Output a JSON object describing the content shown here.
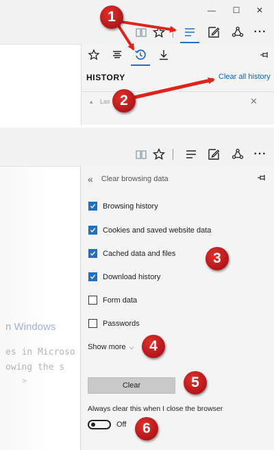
{
  "panel1": {
    "window_controls": {
      "minimize": "—",
      "maximize": "☐",
      "close": "✕"
    },
    "toolbar_icons": [
      "reading-view-icon",
      "favorites-star-icon",
      "hub-icon",
      "web-note-icon",
      "share-icon",
      "more-icon"
    ],
    "more_label": "···",
    "hub_tabs": [
      "favorites-icon",
      "reading-list-icon",
      "history-icon",
      "downloads-icon"
    ],
    "hub_title": "HISTORY",
    "clear_all_history": "Clear all history",
    "row_collapse": "▴",
    "row_label": "Las",
    "row_close": "✕"
  },
  "panel2": {
    "more_label": "···",
    "header": {
      "back": "«",
      "title": "Clear browsing data"
    },
    "options": [
      {
        "label": "Browsing history",
        "checked": true
      },
      {
        "label": "Cookies and saved website data",
        "checked": true
      },
      {
        "label": "Cached data and files",
        "checked": true
      },
      {
        "label": "Download history",
        "checked": true
      },
      {
        "label": "Form data",
        "checked": false
      },
      {
        "label": "Passwords",
        "checked": false
      }
    ],
    "show_more": "Show more",
    "show_more_chevron": "⌵",
    "clear_button": "Clear",
    "always_clear_label": "Always clear this when I close the browser",
    "toggle_state": "Off",
    "background_text": {
      "title": "n Windows",
      "line1": "es in Microso",
      "line2": "owing the s",
      "line3": ">"
    }
  },
  "callouts": [
    "1",
    "2",
    "3",
    "4",
    "5",
    "6"
  ],
  "colors": {
    "accent_blue": "#1f6fc6",
    "link_blue": "#0a64c8",
    "callout_red": "#c0191f",
    "arrow_red": "#e0231b"
  }
}
